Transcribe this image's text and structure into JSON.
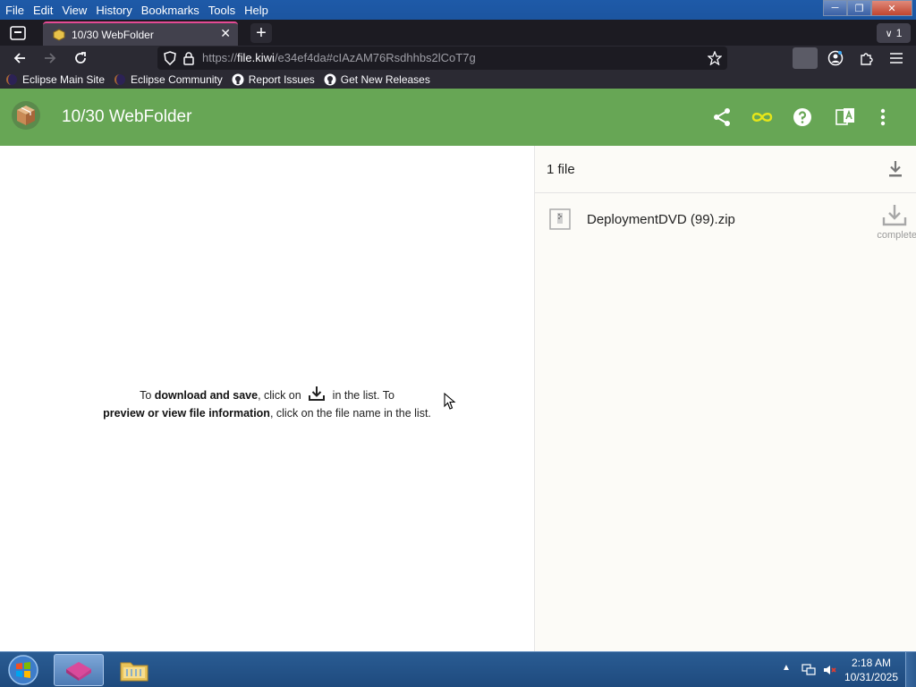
{
  "menu": {
    "items": [
      {
        "label": "File"
      },
      {
        "label": "Edit"
      },
      {
        "label": "View"
      },
      {
        "label": "History"
      },
      {
        "label": "Bookmarks"
      },
      {
        "label": "Tools"
      },
      {
        "label": "Help"
      }
    ]
  },
  "window_controls": {
    "minimize": "─",
    "maximize": "❐",
    "close": "✕"
  },
  "tabs": {
    "active_title": "10/30 WebFolder",
    "close_glyph": "✕",
    "new_tab_glyph": "+",
    "count_label": "1"
  },
  "urlbar": {
    "prefix": "https://",
    "host": "file.kiwi",
    "path": "/e34ef4da#cIAzAM76Rsdhhbs2lCoT7g"
  },
  "bookmarks": [
    {
      "label": "Eclipse Main Site",
      "icon": "eclipse-icon"
    },
    {
      "label": "Eclipse Community",
      "icon": "eclipse-icon"
    },
    {
      "label": "Report Issues",
      "icon": "github-icon"
    },
    {
      "label": "Get New Releases",
      "icon": "github-icon"
    }
  ],
  "app": {
    "title": "10/30 WebFolder",
    "header_color": "#67a655",
    "accent_infinity": "#e6e619"
  },
  "hint": {
    "l1_pre": "To ",
    "l1_bold": "download and save",
    "l1_mid": ", click on ",
    "l1_post": " in the list. To",
    "l2_bold": "preview or view file information",
    "l2_post": ", click on the file name in the list."
  },
  "files": {
    "count_label": "1 file",
    "items": [
      {
        "name": "DeploymentDVD (99).zip",
        "status": "complete"
      }
    ]
  },
  "taskbar": {
    "time": "2:18 AM",
    "date": "10/31/2025"
  }
}
